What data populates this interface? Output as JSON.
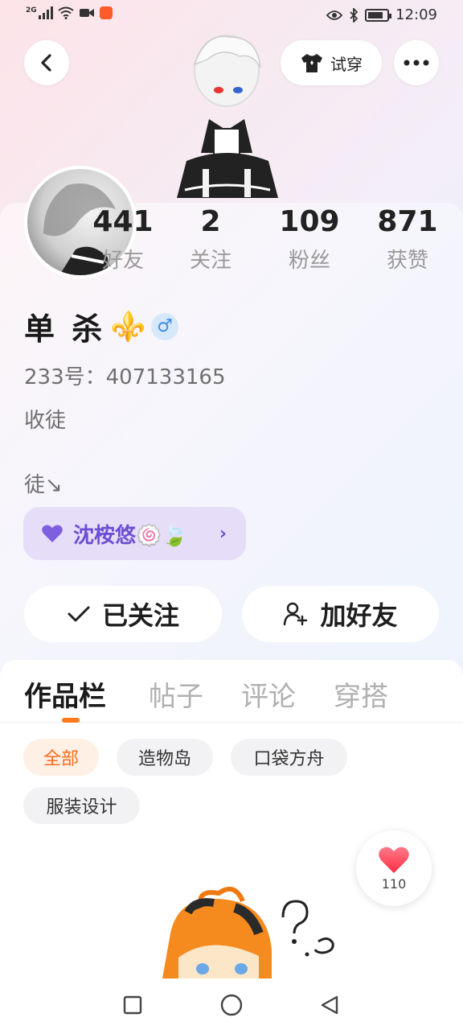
{
  "status_bar": {
    "network": "2G",
    "time": "12:09"
  },
  "header": {
    "try_on_label": "试穿"
  },
  "stats": [
    {
      "value": "441",
      "label": "好友"
    },
    {
      "value": "2",
      "label": "关注"
    },
    {
      "value": "109",
      "label": "粉丝"
    },
    {
      "value": "871",
      "label": "获赞"
    }
  ],
  "profile": {
    "name": "单 杀",
    "name_symbol": "⚜️",
    "gender_symbol": "♂",
    "id_line": "233号：407133165",
    "bio_line1": "收徒",
    "bio_line2": "徒↘",
    "friend_tag": "沈桉悠🍥🍃"
  },
  "actions": {
    "follow_label": "已关注",
    "add_friend_label": "加好友"
  },
  "tabs": [
    "作品栏",
    "帖子",
    "评论",
    "穿搭"
  ],
  "filters": [
    "全部",
    "造物岛",
    "口袋方舟",
    "服装设计"
  ],
  "likes": {
    "count": "110"
  },
  "colors": {
    "accent": "#ff7a1a",
    "friend_tag": "#6a4fd4",
    "heart": "#ff3b4f"
  }
}
